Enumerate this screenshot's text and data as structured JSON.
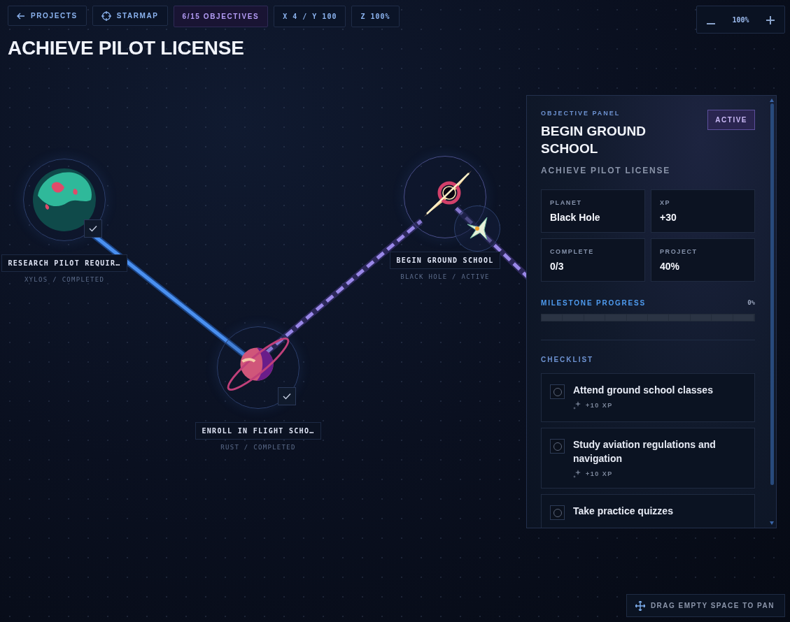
{
  "toolbar": {
    "items": [
      {
        "kind": "back",
        "label": "PROJECTS"
      },
      {
        "kind": "starmap",
        "label": "STARMAP"
      },
      {
        "kind": "count",
        "label": "6/15 OBJECTIVES"
      },
      {
        "kind": "plain",
        "label": "X 4 / Y 100"
      },
      {
        "kind": "plain",
        "label": "Z 100%"
      }
    ]
  },
  "title": "ACHIEVE PILOT LICENSE",
  "zoom_control": {
    "value": "100%"
  },
  "map": {
    "nodes": [
      {
        "kind": "planet",
        "label": "RESEARCH PILOT REQUIR…",
        "subtitle": "XYLOS / COMPLETED",
        "completed": true,
        "selected": false
      },
      {
        "kind": "ringed",
        "label": "ENROLL IN FLIGHT SCHO…",
        "subtitle": "RUST / COMPLETED",
        "completed": true,
        "selected": false
      },
      {
        "kind": "vortex",
        "label": "BEGIN GROUND SCHOOL",
        "subtitle": "BLACK HOLE / ACTIVE",
        "completed": false,
        "selected": true
      }
    ],
    "connectors": [
      {
        "kind": "solid"
      },
      {
        "kind": "dashed"
      },
      {
        "kind": "dashed"
      }
    ]
  },
  "panel": {
    "eyebrow": "OBJECTIVE PANEL",
    "title": "BEGIN GROUND SCHOOL",
    "badge": "ACTIVE",
    "subtitle": "ACHIEVE PILOT LICENSE",
    "stats": [
      {
        "label": "PLANET",
        "value": "Black Hole"
      },
      {
        "label": "XP",
        "value": "+30"
      },
      {
        "label": "COMPLETE",
        "value": "0/3"
      },
      {
        "label": "PROJECT",
        "value": "40%"
      }
    ],
    "milestone": {
      "label": "MILESTONE PROGRESS",
      "reading": "0%",
      "level": 0
    },
    "checklist_heading": "CHECKLIST",
    "checklist": [
      {
        "text": "Attend ground school classes",
        "xp": "+10 XP",
        "checked": false
      },
      {
        "text": "Study aviation regulations and navigation",
        "xp": "+10 XP",
        "checked": false
      },
      {
        "text": "Take practice quizzes",
        "checked": false
      }
    ]
  },
  "hint": "DRAG EMPTY SPACE TO PAN"
}
